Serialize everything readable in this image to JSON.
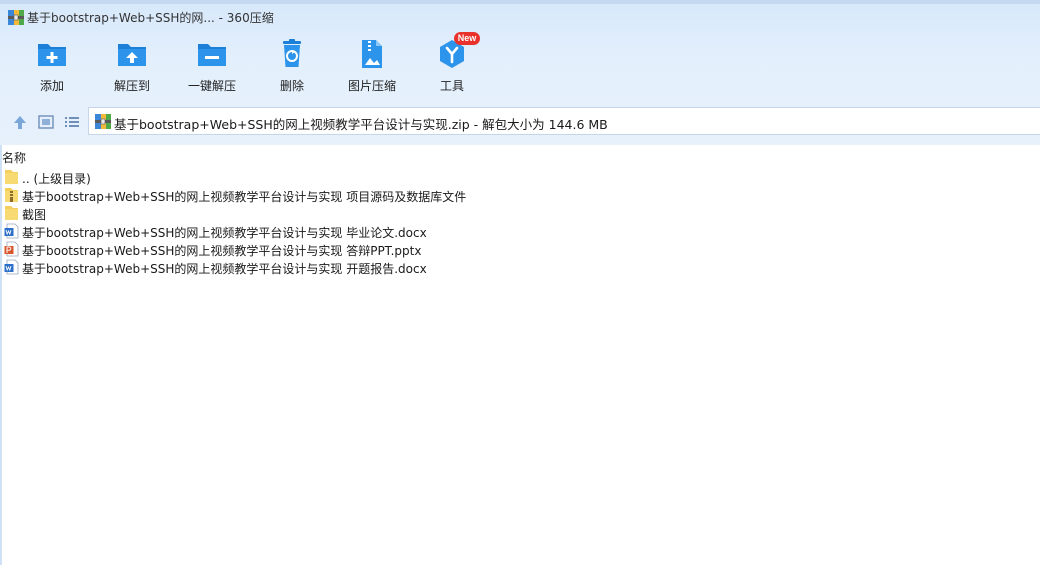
{
  "window": {
    "title": "基于bootstrap+Web+SSH的网... - 360压缩"
  },
  "toolbar": {
    "items": [
      {
        "label": "添加",
        "icon": "folder-add-icon"
      },
      {
        "label": "解压到",
        "icon": "folder-extract-icon"
      },
      {
        "label": "一键解压",
        "icon": "folder-oneclick-extract-icon"
      },
      {
        "label": "删除",
        "icon": "recycle-bin-icon"
      },
      {
        "label": "图片压缩",
        "icon": "image-compress-icon"
      },
      {
        "label": "工具",
        "icon": "tools-icon"
      }
    ],
    "new_badge": "New"
  },
  "address": {
    "text": "基于bootstrap+Web+SSH的网上视频教学平台设计与实现.zip - 解包大小为 144.6 MB"
  },
  "list": {
    "column_name": "名称",
    "rows": [
      {
        "name": ".. (上级目录)",
        "type": "folder"
      },
      {
        "name": "基于bootstrap+Web+SSH的网上视频教学平台设计与实现 项目源码及数据库文件",
        "type": "zip"
      },
      {
        "name": "截图",
        "type": "folder"
      },
      {
        "name": "基于bootstrap+Web+SSH的网上视频教学平台设计与实现 毕业论文.docx",
        "type": "word"
      },
      {
        "name": "基于bootstrap+Web+SSH的网上视频教学平台设计与实现 答辩PPT.pptx",
        "type": "ppt"
      },
      {
        "name": "基于bootstrap+Web+SSH的网上视频教学平台设计与实现 开题报告.docx",
        "type": "word"
      }
    ]
  },
  "colors": {
    "accent_blue": "#2a8fe0",
    "new_badge": "#e8322b",
    "folder_yellow": "#f4cf5b",
    "ppt_orange": "#d9552b",
    "word_blue": "#2b6fc9"
  }
}
